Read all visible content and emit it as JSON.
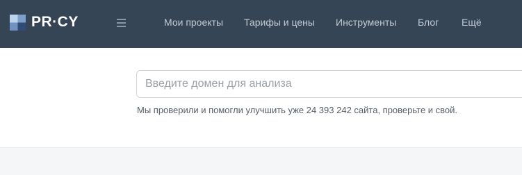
{
  "header": {
    "logo_text": "PR·CY",
    "menu_icon": "hamburger-menu-icon",
    "nav": [
      {
        "label": "Мои проекты"
      },
      {
        "label": "Тарифы и цены"
      },
      {
        "label": "Инструменты"
      },
      {
        "label": "Блог"
      },
      {
        "label": "Ещё"
      }
    ]
  },
  "search": {
    "placeholder": "Введите домен для анализа",
    "value": ""
  },
  "hint_text": "Мы проверили и помогли улучшить уже 24 393 242 сайта, проверьте и свой.",
  "colors": {
    "header_bg": "#364556",
    "nav_text": "#c3cad2",
    "logo_light": "#bcd3ee",
    "logo_mid": "#7d9fc9",
    "logo_dark": "#3e5e8c"
  }
}
